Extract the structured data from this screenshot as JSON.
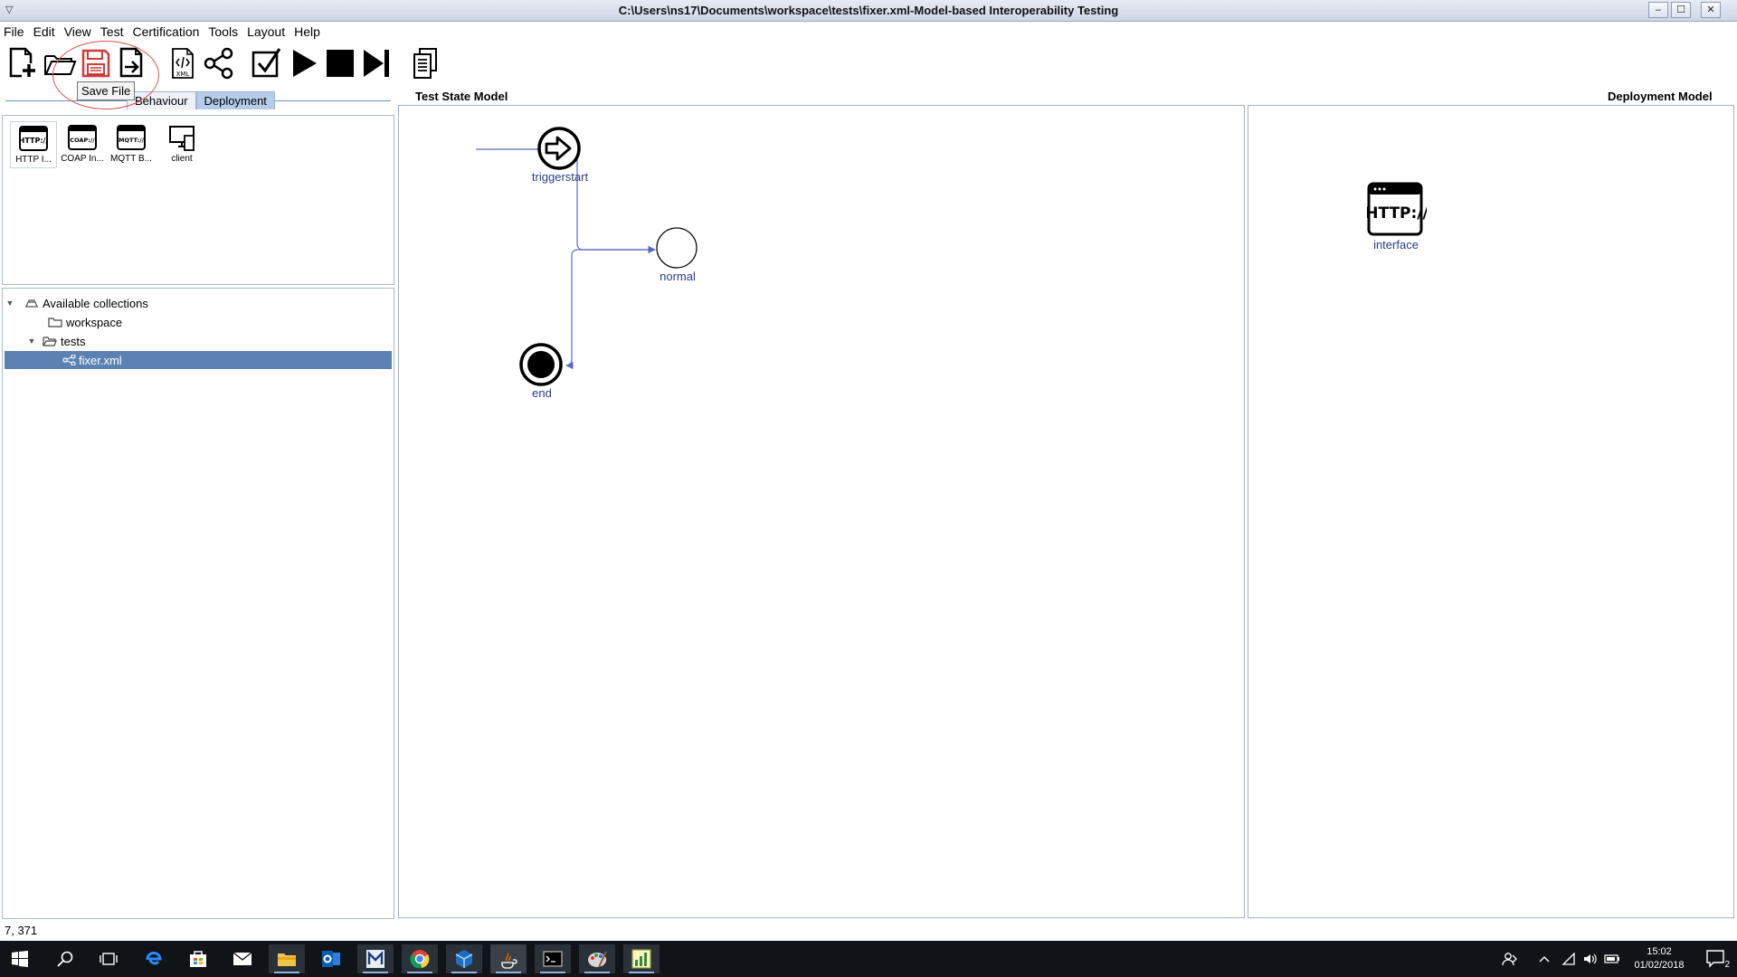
{
  "window": {
    "title": "C:\\Users\\ns17\\Documents\\workspace\\tests\\fixer.xml-Model-based Interoperability Testing",
    "minimize": "‒",
    "maximize": "☐",
    "close": "✕"
  },
  "menu": [
    "File",
    "Edit",
    "View",
    "Test",
    "Certification",
    "Tools",
    "Layout",
    "Help"
  ],
  "toolbar": {
    "icons": [
      "new-file-icon",
      "open-folder-icon",
      "save-file-icon",
      "export-icon",
      "xml-icon",
      "share-graph-icon",
      "check-icon",
      "play-icon",
      "stop-icon",
      "step-icon",
      "copy-report-icon"
    ],
    "tooltip": "Save File",
    "xml_text": "XML"
  },
  "tabs": [
    "Behaviour",
    "Deployment"
  ],
  "active_tab": "Deployment",
  "palette": {
    "items": [
      {
        "label": "HTTP I...",
        "icon": "http-icon",
        "icon_text": "HTTP://"
      },
      {
        "label": "COAP In...",
        "icon": "coap-icon",
        "icon_text": "COAP://"
      },
      {
        "label": "MQTT B...",
        "icon": "mqtt-icon",
        "icon_text": "MQTT://"
      },
      {
        "label": "client",
        "icon": "client-devices-icon",
        "icon_text": ""
      }
    ]
  },
  "tree": {
    "root": "Available collections",
    "items": [
      "workspace",
      "tests",
      "fixer.xml"
    ],
    "selected": "fixer.xml"
  },
  "test_panel": {
    "title": "Test State Model",
    "nodes": [
      {
        "label": "triggerstart",
        "type": "start"
      },
      {
        "label": "normal",
        "type": "state"
      },
      {
        "label": "end",
        "type": "end"
      }
    ]
  },
  "deploy_panel": {
    "title": "Deployment Model",
    "node_label": "interface",
    "node_icon_text": "HTTP://"
  },
  "status": "7, 371",
  "clock": {
    "time": "15:02",
    "date": "01/02/2018"
  },
  "notification_count": "2",
  "colors": {
    "accent": "#5c82b4",
    "link": "#2b3d86",
    "edge": "#5a6bbf"
  }
}
